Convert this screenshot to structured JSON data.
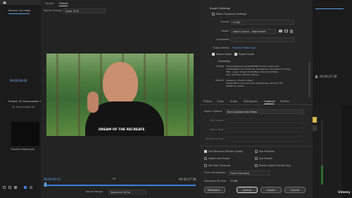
{
  "left_top": {
    "source_tab": "Source: (no clips)",
    "timecode": "00;00;00;00"
  },
  "project_panel": {
    "title": "Project: 41 Transcription Ite",
    "subtitle": "41 Transcription Ite",
    "clip_name": "Practice Video.mp4"
  },
  "export": {
    "tabs": {
      "source": "Source",
      "output": "Output"
    },
    "source_scaling_label": "Source Scaling:",
    "source_scaling_value": "Scale To Fit",
    "video_caption": "DREAM OF THE RECREATE",
    "timecode_left": "00:00:00:11",
    "timecode_right": "00:00:27:38",
    "fit_label": "Fit",
    "source_range_label": "Source Range:",
    "source_range_value": "Sequence In/Out",
    "settings_title": "Export Settings",
    "match_sequence_label": "Match Sequence Settings",
    "format_label": "Format:",
    "format_value": "H.264",
    "preset_label": "Preset:",
    "preset_value": "Match Source - High bitrate",
    "comments_label": "Comments:",
    "output_name_label": "Output Name:",
    "output_name_value": "Practice Video.mp4",
    "export_video_label": "Export Video",
    "export_audio_label": "Export Audio",
    "summary_title": "Summary",
    "summary_output_label": "Output:",
    "summary_output_lines": [
      "/Volumes/Samsung SSD/EDMP Practice Video.mp4",
      "1920x1080 (1.0), 29.97 fps, Progressive, Hardware Encoding,",
      "VBR, 1 pass, Target 20.00 Mbps, Max 24.00 Mbps",
      "AAC, 320 kbps, 48 kHz, Stereo"
    ],
    "summary_source_label": "Source:",
    "summary_source_lines": [
      "Sequence, Practice Video",
      "1920x1080 (1.0), 29.97 fps, Progressive, 00:00:27:38",
      "48000 Hz, Stereo"
    ],
    "settings_tabs": [
      "Effects",
      "Video",
      "Audio",
      "Multiplexer",
      "Captions",
      "Publish"
    ],
    "export_options_label": "Export Options:",
    "export_options_value": "Burn Captions Into Video",
    "file_format_label": "File Format:",
    "frame_rate_label": "Frame Rate:",
    "stream_format_label": "Stream Format:",
    "use_max_render_label": "Use Maximum Render Quality",
    "use_previews_label": "Use Previews",
    "import_into_project_label": "Import into Project",
    "use_proxies_label": "Use Proxies",
    "set_start_timecode_label": "Set Start Timecode",
    "render_alpha_label": "Render Alpha Channel Only",
    "time_interp_label": "Time Interpolation:",
    "time_interp_value": "Frame Sampling",
    "est_file_size_label": "Estimated File Size:",
    "est_file_size_value": "72 MB",
    "buttons": {
      "metadata": "Metadata...",
      "queue": "Queue",
      "export": "Export",
      "cancel": "Cancel"
    }
  },
  "right": {
    "timecode": "00;00;27;38"
  },
  "watermark": "Udemy"
}
